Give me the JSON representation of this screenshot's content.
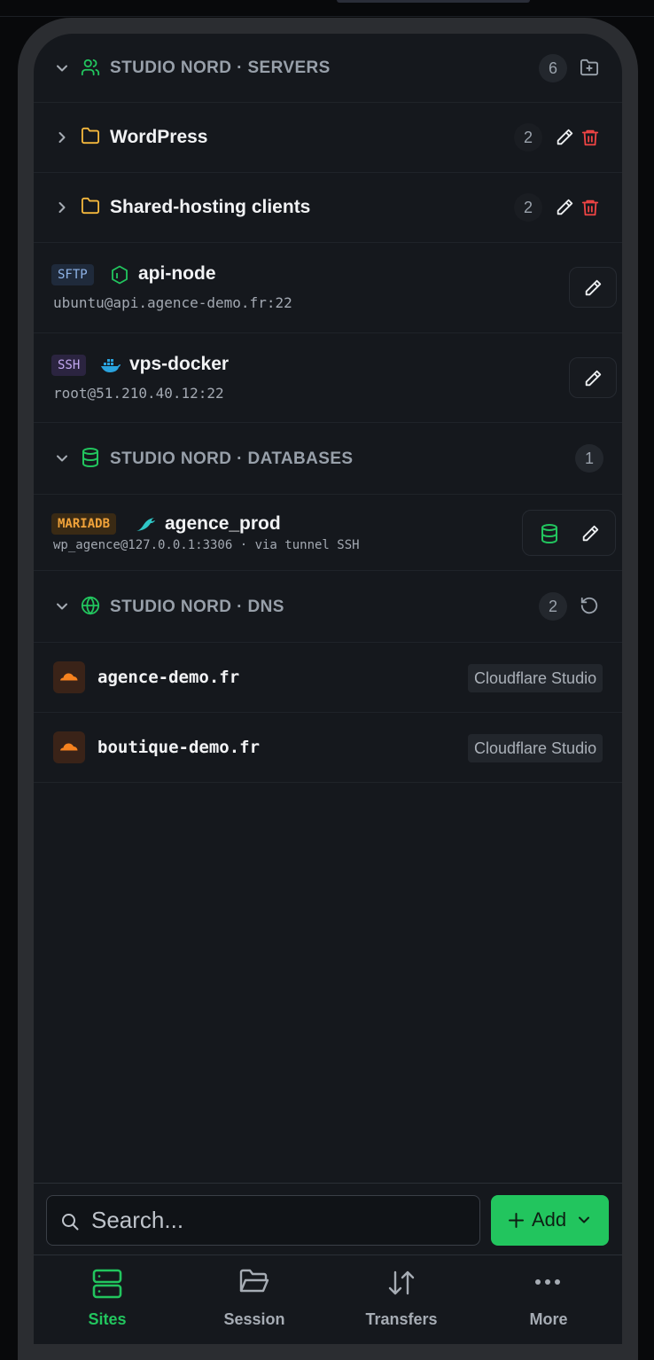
{
  "sections": {
    "servers": {
      "title": "STUDIO NORD · SERVERS",
      "count": "6",
      "folders": [
        {
          "name": "WordPress",
          "count": "2"
        },
        {
          "name": "Shared-hosting clients",
          "count": "2"
        }
      ],
      "hosts": [
        {
          "protocol": "SFTP",
          "name": "api-node",
          "address": "ubuntu@api.agence-demo.fr:22",
          "icon": "node-hexagon-icon"
        },
        {
          "protocol": "SSH",
          "name": "vps-docker",
          "address": "root@51.210.40.12:22",
          "icon": "docker-whale-icon"
        }
      ]
    },
    "databases": {
      "title": "STUDIO NORD · DATABASES",
      "count": "1",
      "items": [
        {
          "engine": "MARIADB",
          "name": "agence_prod",
          "connection": "wp_agence@127.0.0.1:3306 · via tunnel SSH",
          "icon": "mariadb-seal-icon"
        }
      ]
    },
    "dns": {
      "title": "STUDIO NORD · DNS",
      "count": "2",
      "zones": [
        {
          "domain": "agence-demo.fr",
          "provider": "Cloudflare Studio"
        },
        {
          "domain": "boutique-demo.fr",
          "provider": "Cloudflare Studio"
        }
      ]
    }
  },
  "search": {
    "placeholder": "Search..."
  },
  "add_button": {
    "label": "Add"
  },
  "tabs": [
    {
      "label": "Sites",
      "active": true
    },
    {
      "label": "Session",
      "active": false
    },
    {
      "label": "Transfers",
      "active": false
    },
    {
      "label": "More",
      "active": false
    }
  ],
  "colors": {
    "accent": "#22c55e",
    "danger": "#ef4444",
    "folder": "#f5b83d",
    "background": "#15181d"
  }
}
